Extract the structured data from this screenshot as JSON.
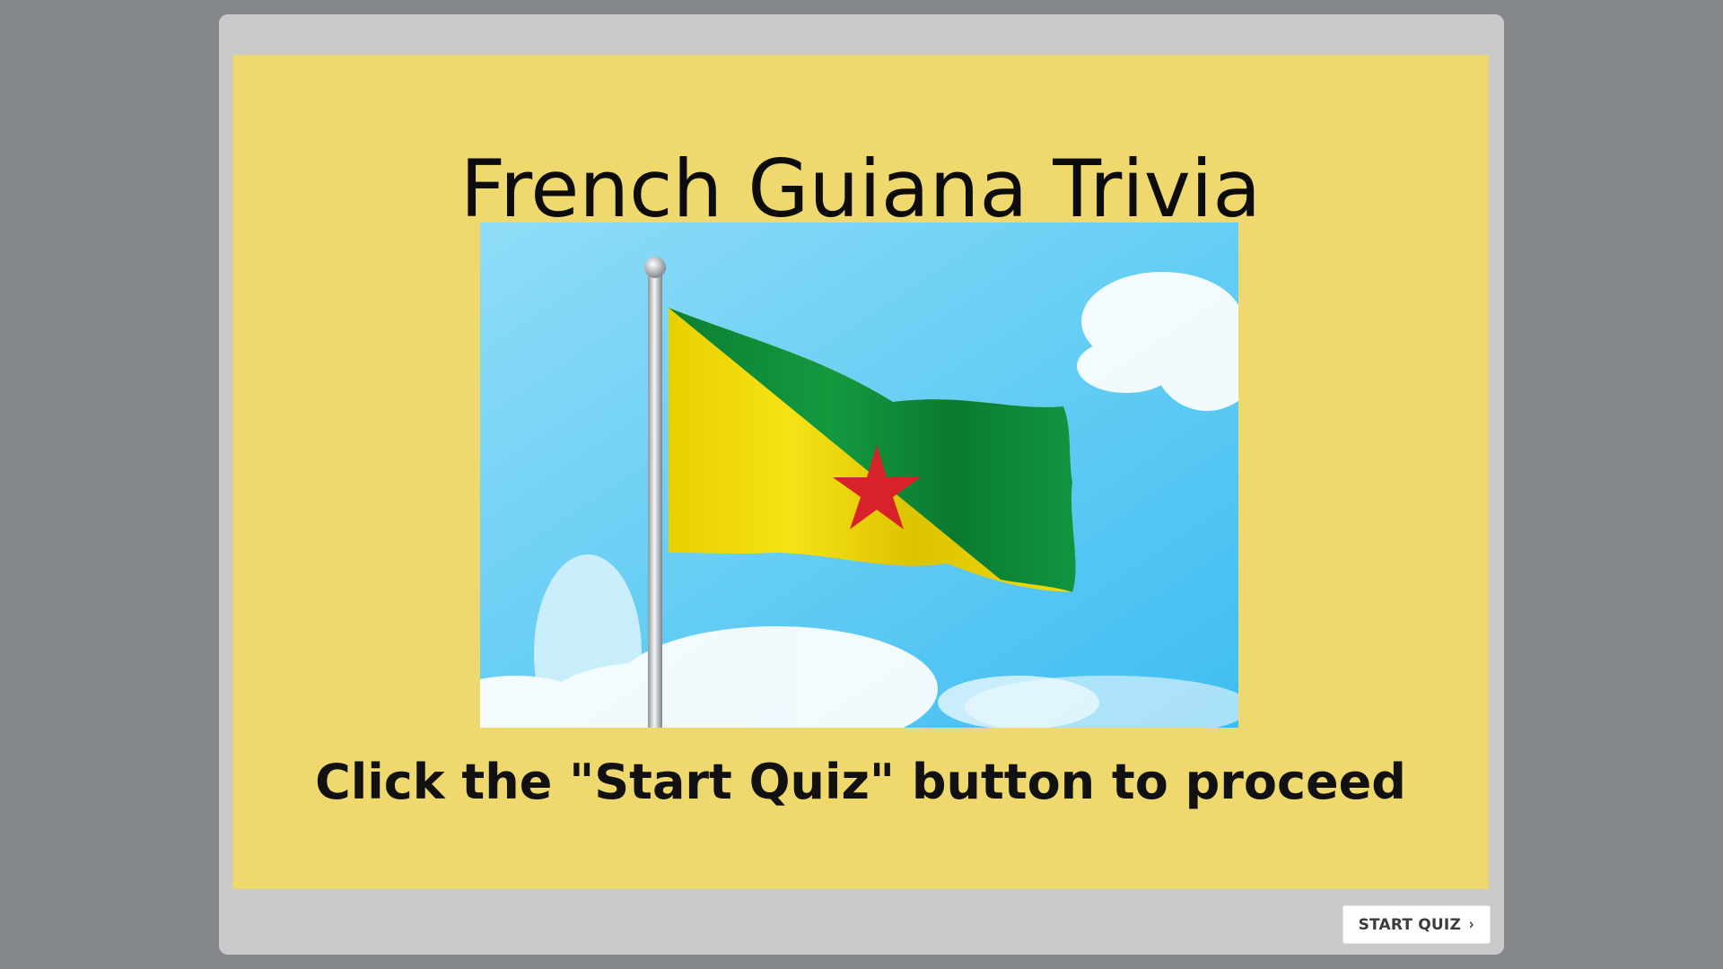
{
  "slide": {
    "title": "French Guiana Trivia",
    "instructions": "Click the \"Start Quiz\" button to proceed",
    "image_description_icon": "french-guiana-flag-icon"
  },
  "navigation": {
    "start_label": "START QUIZ",
    "start_chevron": "›"
  },
  "colors": {
    "background": "#84878b",
    "player_frame": "#cacaca",
    "slide_background": "#efd96f",
    "flag_green": "#0e8c3a",
    "flag_yellow": "#f2dc07",
    "flag_star": "#d8222a",
    "sky": "#6fd0f4"
  }
}
